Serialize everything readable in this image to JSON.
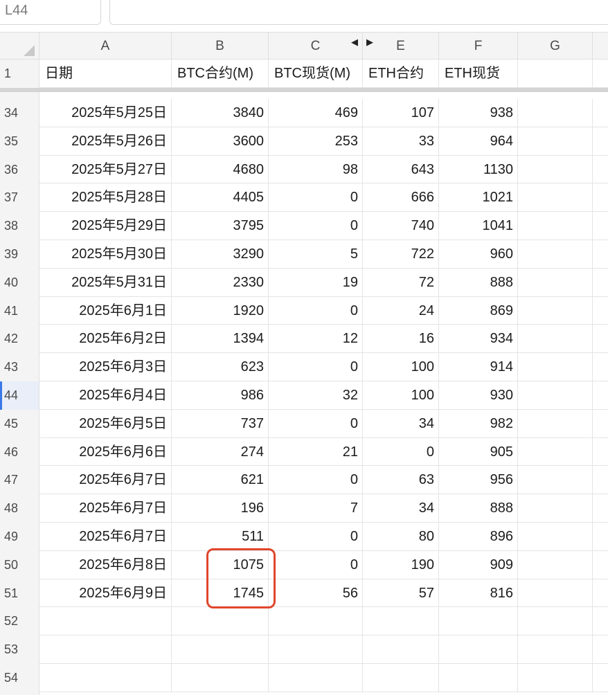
{
  "name_box": {
    "value": "L44"
  },
  "formula_bar": {
    "value": ""
  },
  "columns": [
    "A",
    "B",
    "C",
    "E",
    "F",
    "G"
  ],
  "header_row": {
    "row_number": "1",
    "cells": [
      "日期",
      "BTC合约(M)",
      "BTC现货(M)",
      "ETH合约",
      "ETH现货",
      ""
    ]
  },
  "rows": [
    {
      "n": "34",
      "date": "2025年5月25日",
      "btc_fut": "3840",
      "btc_spot": "469",
      "eth_fut": "107",
      "eth_spot": "938"
    },
    {
      "n": "35",
      "date": "2025年5月26日",
      "btc_fut": "3600",
      "btc_spot": "253",
      "eth_fut": "33",
      "eth_spot": "964"
    },
    {
      "n": "36",
      "date": "2025年5月27日",
      "btc_fut": "4680",
      "btc_spot": "98",
      "eth_fut": "643",
      "eth_spot": "1130"
    },
    {
      "n": "37",
      "date": "2025年5月28日",
      "btc_fut": "4405",
      "btc_spot": "0",
      "eth_fut": "666",
      "eth_spot": "1021"
    },
    {
      "n": "38",
      "date": "2025年5月29日",
      "btc_fut": "3795",
      "btc_spot": "0",
      "eth_fut": "740",
      "eth_spot": "1041"
    },
    {
      "n": "39",
      "date": "2025年5月30日",
      "btc_fut": "3290",
      "btc_spot": "5",
      "eth_fut": "722",
      "eth_spot": "960"
    },
    {
      "n": "40",
      "date": "2025年5月31日",
      "btc_fut": "2330",
      "btc_spot": "19",
      "eth_fut": "72",
      "eth_spot": "888"
    },
    {
      "n": "41",
      "date": "2025年6月1日",
      "btc_fut": "1920",
      "btc_spot": "0",
      "eth_fut": "24",
      "eth_spot": "869"
    },
    {
      "n": "42",
      "date": "2025年6月2日",
      "btc_fut": "1394",
      "btc_spot": "12",
      "eth_fut": "16",
      "eth_spot": "934"
    },
    {
      "n": "43",
      "date": "2025年6月3日",
      "btc_fut": "623",
      "btc_spot": "0",
      "eth_fut": "100",
      "eth_spot": "914"
    },
    {
      "n": "44",
      "date": "2025年6月4日",
      "btc_fut": "986",
      "btc_spot": "32",
      "eth_fut": "100",
      "eth_spot": "930"
    },
    {
      "n": "45",
      "date": "2025年6月5日",
      "btc_fut": "737",
      "btc_spot": "0",
      "eth_fut": "34",
      "eth_spot": "982"
    },
    {
      "n": "46",
      "date": "2025年6月6日",
      "btc_fut": "274",
      "btc_spot": "21",
      "eth_fut": "0",
      "eth_spot": "905"
    },
    {
      "n": "47",
      "date": "2025年6月7日",
      "btc_fut": "621",
      "btc_spot": "0",
      "eth_fut": "63",
      "eth_spot": "956"
    },
    {
      "n": "48",
      "date": "2025年6月7日",
      "btc_fut": "196",
      "btc_spot": "7",
      "eth_fut": "34",
      "eth_spot": "888"
    },
    {
      "n": "49",
      "date": "2025年6月7日",
      "btc_fut": "511",
      "btc_spot": "0",
      "eth_fut": "80",
      "eth_spot": "896"
    },
    {
      "n": "50",
      "date": "2025年6月8日",
      "btc_fut": "1075",
      "btc_spot": "0",
      "eth_fut": "190",
      "eth_spot": "909"
    },
    {
      "n": "51",
      "date": "2025年6月9日",
      "btc_fut": "1745",
      "btc_spot": "56",
      "eth_fut": "57",
      "eth_spot": "816"
    },
    {
      "n": "52",
      "date": "",
      "btc_fut": "",
      "btc_spot": "",
      "eth_fut": "",
      "eth_spot": ""
    },
    {
      "n": "53",
      "date": "",
      "btc_fut": "",
      "btc_spot": "",
      "eth_fut": "",
      "eth_spot": ""
    },
    {
      "n": "54",
      "date": "",
      "btc_fut": "",
      "btc_spot": "",
      "eth_fut": "",
      "eth_spot": ""
    }
  ],
  "active_row": "44",
  "highlight_color": "#e0462c",
  "accent_color": "#3b78e7"
}
